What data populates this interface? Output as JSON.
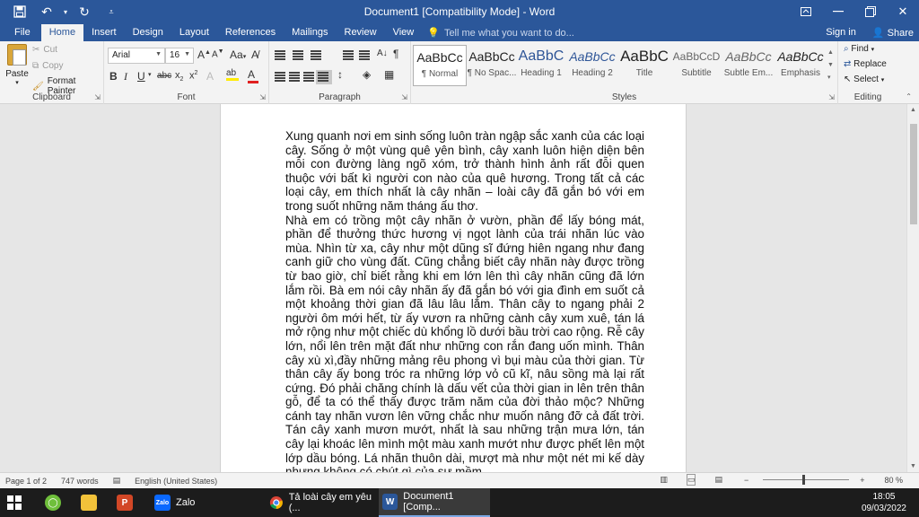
{
  "window": {
    "title": "Document1 [Compatibility Mode] - Word"
  },
  "tabs": [
    "File",
    "Home",
    "Insert",
    "Design",
    "Layout",
    "References",
    "Mailings",
    "Review",
    "View"
  ],
  "tellme": "Tell me what you want to do...",
  "signin": "Sign in",
  "share": "Share",
  "clipboard": {
    "label": "Clipboard",
    "paste": "Paste",
    "cut": "Cut",
    "copy": "Copy",
    "format_painter": "Format Painter"
  },
  "font": {
    "label": "Font",
    "family": "Arial",
    "size": "16",
    "aa": "Aa"
  },
  "paragraph": {
    "label": "Paragraph"
  },
  "styles": {
    "label": "Styles",
    "items": [
      {
        "preview": "AaBbCc",
        "name": "¶ Normal"
      },
      {
        "preview": "AaBbCc",
        "name": "¶ No Spac..."
      },
      {
        "preview": "AaBbC",
        "name": "Heading 1"
      },
      {
        "preview": "AaBbCc",
        "name": "Heading 2"
      },
      {
        "preview": "AaBbC",
        "name": "Title"
      },
      {
        "preview": "AaBbCcD",
        "name": "Subtitle"
      },
      {
        "preview": "AaBbCc",
        "name": "Subtle Em..."
      },
      {
        "preview": "AaBbCc",
        "name": "Emphasis"
      }
    ]
  },
  "editing": {
    "label": "Editing",
    "find": "Find",
    "replace": "Replace",
    "select": "Select"
  },
  "document": {
    "p1": "Xung quanh nơi em sinh sống luôn tràn ngập sắc xanh của các loại cây. Sống ở một vùng quê yên bình, cây xanh luôn hiện diện bên mỗi con đường làng ngõ xóm, trở thành hình ảnh rất đỗi quen thuộc với bất kì người con nào của quê hương. Trong tất cả các loại cây, em thích nhất là cây nhãn – loài cây đã gắn bó với em trong suốt những năm tháng ấu thơ.",
    "p2": "Nhà em có trồng một cây nhãn ở vườn, phần để lấy bóng mát, phần để thưởng thức hương vị ngọt lành của trái nhãn lúc vào mùa. Nhìn từ xa, cây như một dũng sĩ đứng hiên ngang như đang canh giữ cho vùng đất. Cũng chẳng biết cây nhãn này được trồng từ bao giờ, chỉ biết rằng khi em lớn lên thì cây nhãn cũng đã lớn lắm rồi. Bà em nói cây nhãn ấy đã gắn bó với gia đình em suốt cả một khoảng thời gian đã lâu lâu lắm. Thân cây to ngang phải 2 người ôm mới hết, từ ấy vươn ra những cành cây xum xuê, tán lá mở rộng như một chiếc dù khổng lồ dưới bầu trời cao rộng. Rễ cây lớn, nổi lên trên mặt đất như những con rắn đang uốn mình. Thân cây xù xì,đầy những mảng rêu phong vì bụi màu của thời gian. Từ thân cây ấy bong tróc ra những lớp vỏ cũ kĩ, nâu sồng mà lại rất cứng. Đó phải chăng chính là dấu vết của thời gian in lên trên thân gỗ, để ta có thể thấy được trăm năm của đời thảo mộc? Những cánh tay nhãn vươn lên vững chắc như muốn nâng đỡ cả đất trời. Tán cây xanh mươn mướt, nhất là sau những trận mưa lớn, tán cây lại khoác lên mình một màu xanh mướt như được phết lên một lớp dầu bóng. Lá nhãn thuôn dài, mượt mà như một nét mi kế dày nhưng không có chút gì của sự mềm"
  },
  "status": {
    "page": "Page 1 of 2",
    "words": "747 words",
    "language": "English (United States)",
    "zoom": "80 %"
  },
  "taskbar": {
    "zalo": "Zalo",
    "chrome": "Tả loài cây em yêu (...",
    "word": "Document1 [Comp...",
    "time": "18:05",
    "date": "09/03/2022"
  },
  "colors": {
    "accent": "#2b579a",
    "ribbon": "#f3f3f3",
    "taskbar": "#1c1c1c"
  }
}
